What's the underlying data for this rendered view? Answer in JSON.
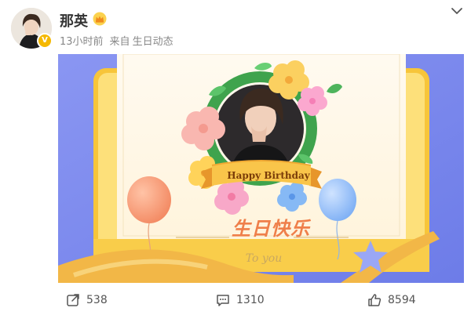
{
  "post": {
    "author": {
      "name": "那英"
    },
    "meta": {
      "time": "13小时前",
      "source_prefix": "来自",
      "source": "生日动态"
    },
    "card": {
      "greeting": "Happy Birthday",
      "chinese_title": "生日快乐",
      "sign_off": "To you"
    },
    "actions": {
      "repost_count": "538",
      "comment_count": "1310",
      "like_count": "8594"
    }
  },
  "colors": {
    "card_background": "#7e8cf0",
    "frame_yellow": "#f7c53a",
    "ribbon_gold": "#f5b03d",
    "wreath_green": "#3fa34d",
    "verify_badge": "#f5b800"
  },
  "icons": {
    "crown": "crown-icon",
    "more": "chevron-down-icon",
    "repost": "share-icon",
    "comment": "comment-icon",
    "like": "thumbs-up-icon"
  }
}
